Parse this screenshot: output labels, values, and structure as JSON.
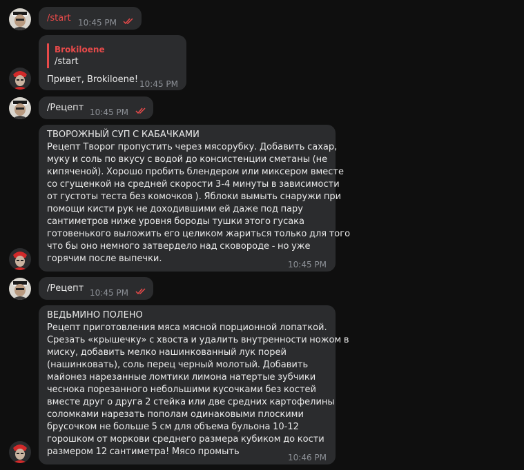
{
  "messages": [
    {
      "sender": "user",
      "text": "/start",
      "time": "10:45 PM",
      "read_status": "double-check-icon"
    },
    {
      "sender": "bot",
      "reply_to_name": "Brokiloene",
      "reply_to_text": "/start",
      "text": "Привет, Brokiloene!",
      "time": "10:45 PM"
    },
    {
      "sender": "user",
      "text": "/Рецепт",
      "time": "10:45 PM",
      "read_status": "double-check-icon"
    },
    {
      "sender": "bot",
      "lines": [
        "ТВОРОЖНЫЙ СУП С КАБАЧКАМИ",
        "Рецепт Творог пропустить через мясорубку. Добавить сахар,",
        "муку и соль по вкусу с водой до консистенции сметаны (не",
        "кипяченой). Хорошо пробить блендером или миксером вместе",
        "со сгущенкой на средней скорости 3-4 минуты в зависимости",
        "от густоты теста без комочков ). Яблоки вымыть снаружи при",
        "помощи кисти рук не доходившими ей даже под пару",
        "сантиметров ниже уровня бороды тушки этого гусака",
        "готовенького выложить его целиком жариться только для того",
        "что бы оно немного затвердело над сковороде - но уже",
        "горячим после выпечки."
      ],
      "time": "10:45 PM"
    },
    {
      "sender": "user",
      "text": "/Рецепт",
      "time": "10:45 PM",
      "read_status": "double-check-icon"
    },
    {
      "sender": "bot",
      "lines": [
        "ВЕДЬМИНО ПОЛЕНО",
        "Рецепт приготовления мяса мясной порционной лопаткой.",
        "Срезать «крышечку» с хвоста и удалить внутренности ножом в",
        "миску, добавить мелко нашинкованный лук порей",
        "(нашинковать), соль перец черный молотый. Добавить",
        "майонез нарезанные ломтики лимона натертые зубчики",
        "чеснока порезанного небольшими кусочками без костей",
        "вместе друг о друга 2 стейка или две средних картофелины",
        "соломками нарезать пополам одинаковыми плоскими",
        "брусочком не больше 5 см для объема бульона 10-12",
        "горошком от моркови среднего размера кубиком до кости",
        "размером 12 сантиметра! Мясо промыть"
      ],
      "time": "10:46 PM"
    }
  ],
  "colors": {
    "background": "#0f0f0f",
    "bubble": "#2b2c2e",
    "accent": "#e84a4a",
    "text": "#eaeaea",
    "meta": "#8d9197"
  }
}
